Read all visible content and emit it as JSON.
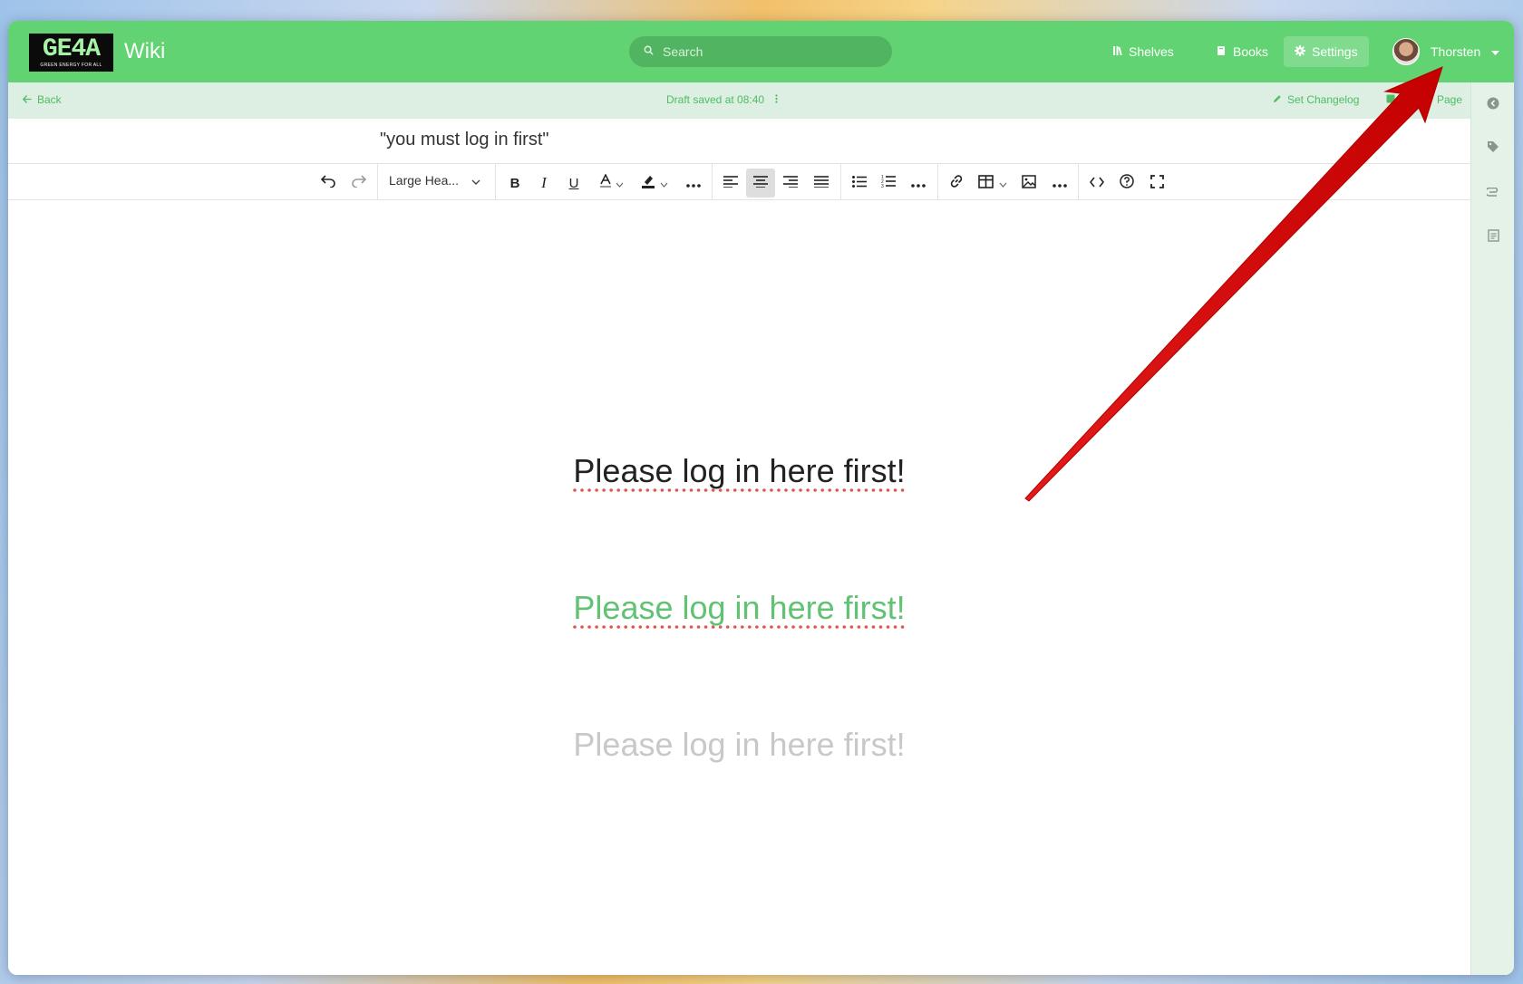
{
  "header": {
    "logo_text": "GE4A",
    "logo_tagline": "GREEN ENERGY FOR ALL",
    "app_title": "Wiki",
    "search_placeholder": "Search",
    "nav": {
      "shelves": "Shelves",
      "books": "Books",
      "settings": "Settings"
    },
    "user_name": "Thorsten"
  },
  "subbar": {
    "back_label": "Back",
    "draft_status": "Draft saved at 08:40",
    "set_changelog": "Set Changelog",
    "page_label": "Page"
  },
  "page": {
    "title": "\"you must log in first\""
  },
  "toolbar": {
    "block_format": "Large Hea..."
  },
  "content": {
    "headings": [
      "Please log in here first!",
      "Please log in here first!",
      "Please log in here first!"
    ]
  },
  "colors": {
    "brand_green": "#62d373",
    "annotation_arrow": "#e01818"
  }
}
